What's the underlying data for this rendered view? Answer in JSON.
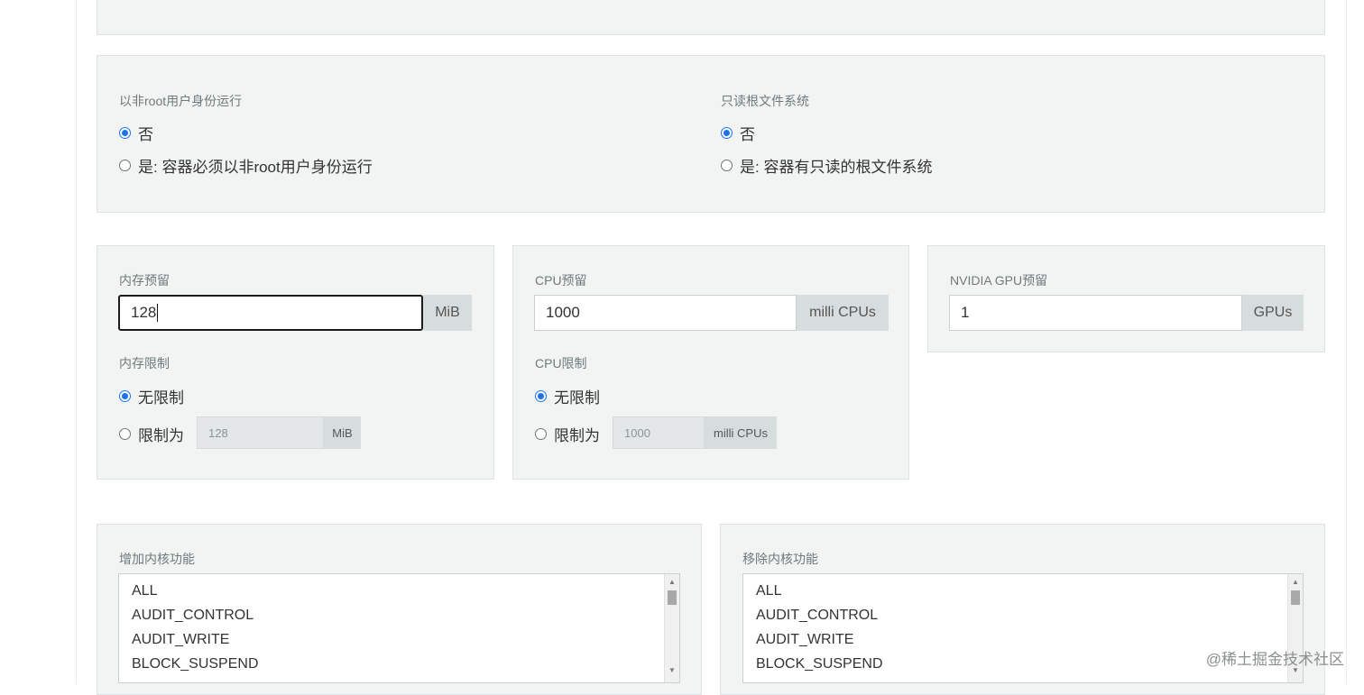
{
  "security": {
    "run_as_non_root": {
      "label": "以非root用户身份运行",
      "options": [
        "否",
        "是: 容器必须以非root用户身份运行"
      ],
      "selected": 0
    },
    "read_only_root_fs": {
      "label": "只读根文件系统",
      "options": [
        "否",
        "是: 容器有只读的根文件系统"
      ],
      "selected": 0
    }
  },
  "memory": {
    "reservation_label": "内存预留",
    "reservation_value": "128",
    "reservation_unit": "MiB",
    "limit_label": "内存限制",
    "limit_options": [
      "无限制",
      "限制为"
    ],
    "limit_selected": 0,
    "limit_value": "128",
    "limit_unit": "MiB"
  },
  "cpu": {
    "reservation_label": "CPU预留",
    "reservation_value": "1000",
    "reservation_unit": "milli CPUs",
    "limit_label": "CPU限制",
    "limit_options": [
      "无限制",
      "限制为"
    ],
    "limit_selected": 0,
    "limit_value": "1000",
    "limit_unit": "milli CPUs"
  },
  "gpu": {
    "reservation_label": "NVIDIA GPU预留",
    "reservation_value": "1",
    "reservation_unit": "GPUs"
  },
  "capabilities": {
    "add_label": "增加内核功能",
    "drop_label": "移除内核功能",
    "options": [
      "ALL",
      "AUDIT_CONTROL",
      "AUDIT_WRITE",
      "BLOCK_SUSPEND"
    ]
  },
  "watermark": "@稀土掘金技术社区",
  "icons": {
    "scroll_up": "up-arrow-icon",
    "scroll_down": "down-arrow-icon"
  }
}
